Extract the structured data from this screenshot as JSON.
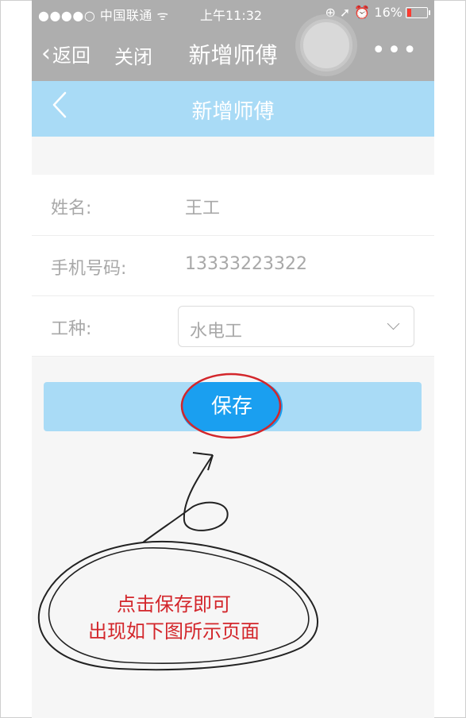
{
  "status_bar": {
    "carrier": "●●●●○ 中国联通 ᯤ",
    "time": "上午11:32",
    "indicators": "⊕ ➚ ⏰ 16%"
  },
  "nav_bar": {
    "back_label": "返回",
    "close_label": "关闭",
    "title": "新增师傅",
    "more_label": "•••"
  },
  "page_header": {
    "back_icon": "chevron-left-icon",
    "title": "新增师傅"
  },
  "form": {
    "name_label": "姓名:",
    "name_value": "王工",
    "phone_label": "手机号码:",
    "phone_value": "13333223322",
    "trade_label": "工种:",
    "trade_value": "水电工"
  },
  "save_button": {
    "label": "保存"
  },
  "annotation": {
    "line1": "点击保存即可",
    "line2": "出现如下图所示页面",
    "color": "#d3262b"
  },
  "colors": {
    "header_bg": "#a9dbf6",
    "button_accent": "#1a9ff0",
    "wechat_nav": "#aeaeae"
  }
}
